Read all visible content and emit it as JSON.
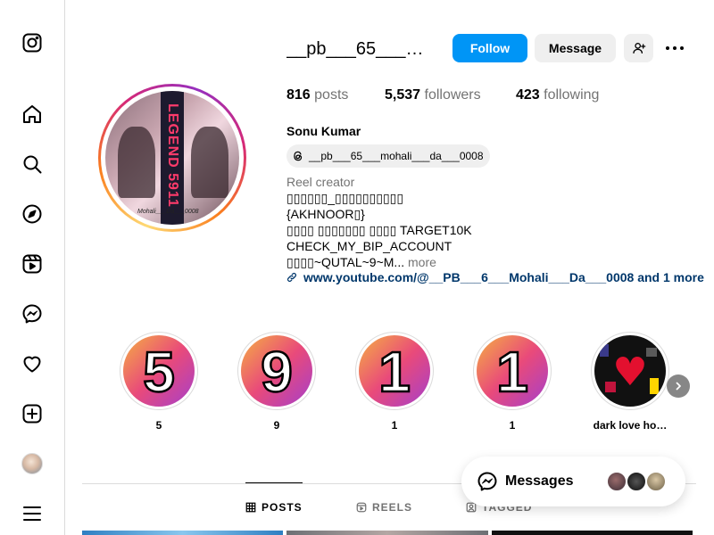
{
  "sidebar": {
    "items": [
      {
        "name": "instagram-logo-icon"
      },
      {
        "name": "home-icon"
      },
      {
        "name": "search-icon"
      },
      {
        "name": "explore-icon"
      },
      {
        "name": "reels-icon"
      },
      {
        "name": "messenger-icon"
      },
      {
        "name": "notifications-heart-icon"
      },
      {
        "name": "create-plus-icon"
      },
      {
        "name": "profile-avatar"
      },
      {
        "name": "more-menu-icon"
      }
    ]
  },
  "profile": {
    "username": "__pb___65___mohali___da___0008",
    "follow_label": "Follow",
    "message_label": "Message",
    "posts_count": "816",
    "posts_label": "posts",
    "followers_count": "5,537",
    "followers_label": "followers",
    "following_count": "423",
    "following_label": "following",
    "full_name": "Sonu Kumar",
    "threads_handle": "__pb___65___mohali___da___0008",
    "category": "Reel creator",
    "bio_lines": [
      "▯▯▯▯▯▯_▯▯▯▯▯▯▯▯▯▯",
      "{AKHNOOR▯}",
      "▯▯▯▯ ▯▯▯▯▯▯▯ ▯▯▯▯ TARGET10K",
      "CHECK_MY_BIP_ACCOUNT",
      "▯▯▯▯~QUTAL~9~M..."
    ],
    "more_label": "more",
    "website": "www.youtube.com/@__PB___6___Mohali___Da___0008 and 1 more",
    "pic_text": "LEGEND 5911",
    "pic_signature": "Mohali___Da___0008"
  },
  "highlights": [
    {
      "label": "5",
      "glyph": "5"
    },
    {
      "label": "9",
      "glyph": "9"
    },
    {
      "label": "1",
      "glyph": "1"
    },
    {
      "label": "1",
      "glyph": "1"
    },
    {
      "label": "dark love ho…",
      "glyph": "♥"
    }
  ],
  "tabs": [
    {
      "label": "POSTS",
      "active": true
    },
    {
      "label": "REELS",
      "active": false
    },
    {
      "label": "TAGGED",
      "active": false
    }
  ],
  "messages": {
    "label": "Messages"
  },
  "colors": {
    "accent": "#0095f6",
    "link": "#00376b",
    "muted": "#737373",
    "border": "#dbdbdb"
  }
}
